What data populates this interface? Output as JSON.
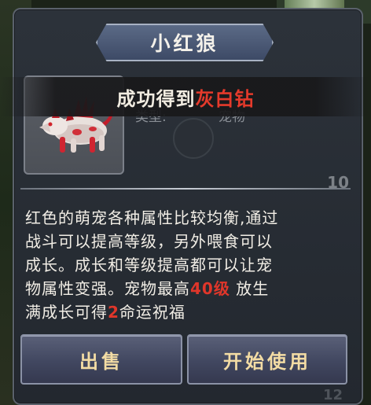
{
  "title": "小红狼",
  "banner": {
    "prefix": "成功得到",
    "item": "灰白钻"
  },
  "info": {
    "type_label": "类型:",
    "type_value": "宠物",
    "level_hint": "10"
  },
  "description": {
    "line1": "红色的萌宠各种属性比较均衡,通过",
    "line2": "战斗可以提高等级，另外喂食可以",
    "line3": "成长。成长和等级提高都可以让宠",
    "line4_pre": "物属性变强。宠物最高",
    "line4_level": "40级",
    "line4_post": "放生",
    "line5_pre": "满成长可得",
    "line5_num": "2",
    "line5_post": "命运祝福"
  },
  "buttons": {
    "sell": "出售",
    "use": "开始使用"
  },
  "bottom_hint": "12",
  "colors": {
    "accent_red": "#e53a2b",
    "button_text": "#f3dca4",
    "panel": "#2c323a"
  },
  "icons": {
    "pet": "red-wolf-pet-icon"
  }
}
